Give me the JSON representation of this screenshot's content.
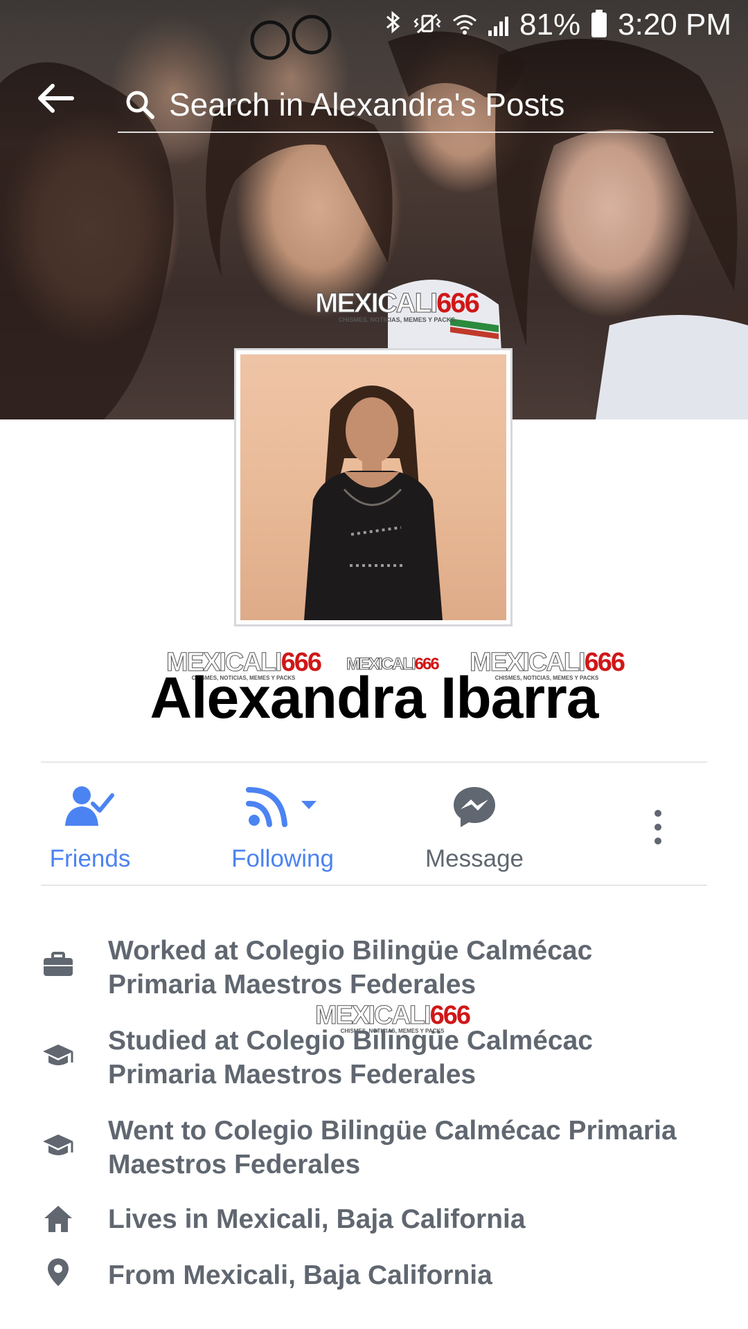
{
  "status_bar": {
    "battery": "81%",
    "time": "3:20 PM"
  },
  "search": {
    "placeholder": "Search in Alexandra's Posts"
  },
  "watermark": {
    "text_main": "MEXICALI",
    "text_num": "666",
    "subtitle": "CHISMES, NOTICIAS, MEMES Y PACKS"
  },
  "profile": {
    "name": "Alexandra Ibarra"
  },
  "actions": [
    {
      "label": "Friends",
      "icon": "friends-check-icon"
    },
    {
      "label": "Following",
      "icon": "rss-follow-icon"
    },
    {
      "label": "Message",
      "icon": "messenger-icon"
    },
    {
      "label": "",
      "icon": "more-vertical-icon"
    }
  ],
  "about": [
    {
      "icon": "briefcase-icon",
      "text": "Worked at Colegio Bilingüe Calmécac Primaria Maestros Federales"
    },
    {
      "icon": "graduation-cap-icon",
      "text": "Studied at Colegio Bilingüe Calmécac Primaria Maestros Federales"
    },
    {
      "icon": "graduation-cap-icon",
      "text": "Went to Colegio Bilingüe Calmécac Primaria Maestros Federales"
    },
    {
      "icon": "home-icon",
      "text": "Lives in Mexicali, Baja California"
    },
    {
      "icon": "location-pin-icon",
      "text": "From Mexicali, Baja California"
    }
  ],
  "colors": {
    "accent_blue": "#4267b2",
    "link_blue": "#4b83f2",
    "text_gray": "#606770",
    "watermark_red": "#d01717"
  }
}
